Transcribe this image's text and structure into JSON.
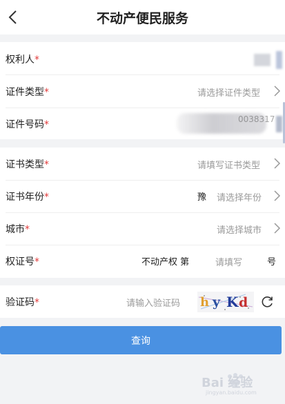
{
  "header": {
    "title": "不动产便民服务",
    "back_icon": "chevron-left-icon"
  },
  "rows": {
    "owner": {
      "label": "权利人",
      "required_mark": "*"
    },
    "cert_type": {
      "label": "证件类型",
      "required_mark": "*",
      "placeholder": "请选择证件类型"
    },
    "cert_no": {
      "label": "证件号码",
      "required_mark": "*",
      "partial_value": "0038317"
    },
    "book_type": {
      "label": "证书类型",
      "required_mark": "*",
      "placeholder": "请填写证书类型"
    },
    "book_year": {
      "label": "证书年份",
      "required_mark": "*",
      "prefix": "豫",
      "placeholder": "请选择年份"
    },
    "city": {
      "label": "城市",
      "required_mark": "*",
      "placeholder": "请选择城市"
    },
    "right_no": {
      "label": "权证号",
      "required_mark": "*",
      "prefix": "不动产权 第",
      "placeholder": "请填写",
      "suffix": "号"
    },
    "captcha": {
      "label": "验证码",
      "required_mark": "*",
      "placeholder": "请输入验证码",
      "captcha_text": "hyKd"
    }
  },
  "submit": {
    "label": "查询"
  },
  "watermark": {
    "text": "Bai 经验",
    "sub": "jingyan.baidu.com"
  },
  "colors": {
    "accent": "#4a91e2",
    "required": "#e23b3b",
    "placeholder": "#9a9a9a"
  }
}
